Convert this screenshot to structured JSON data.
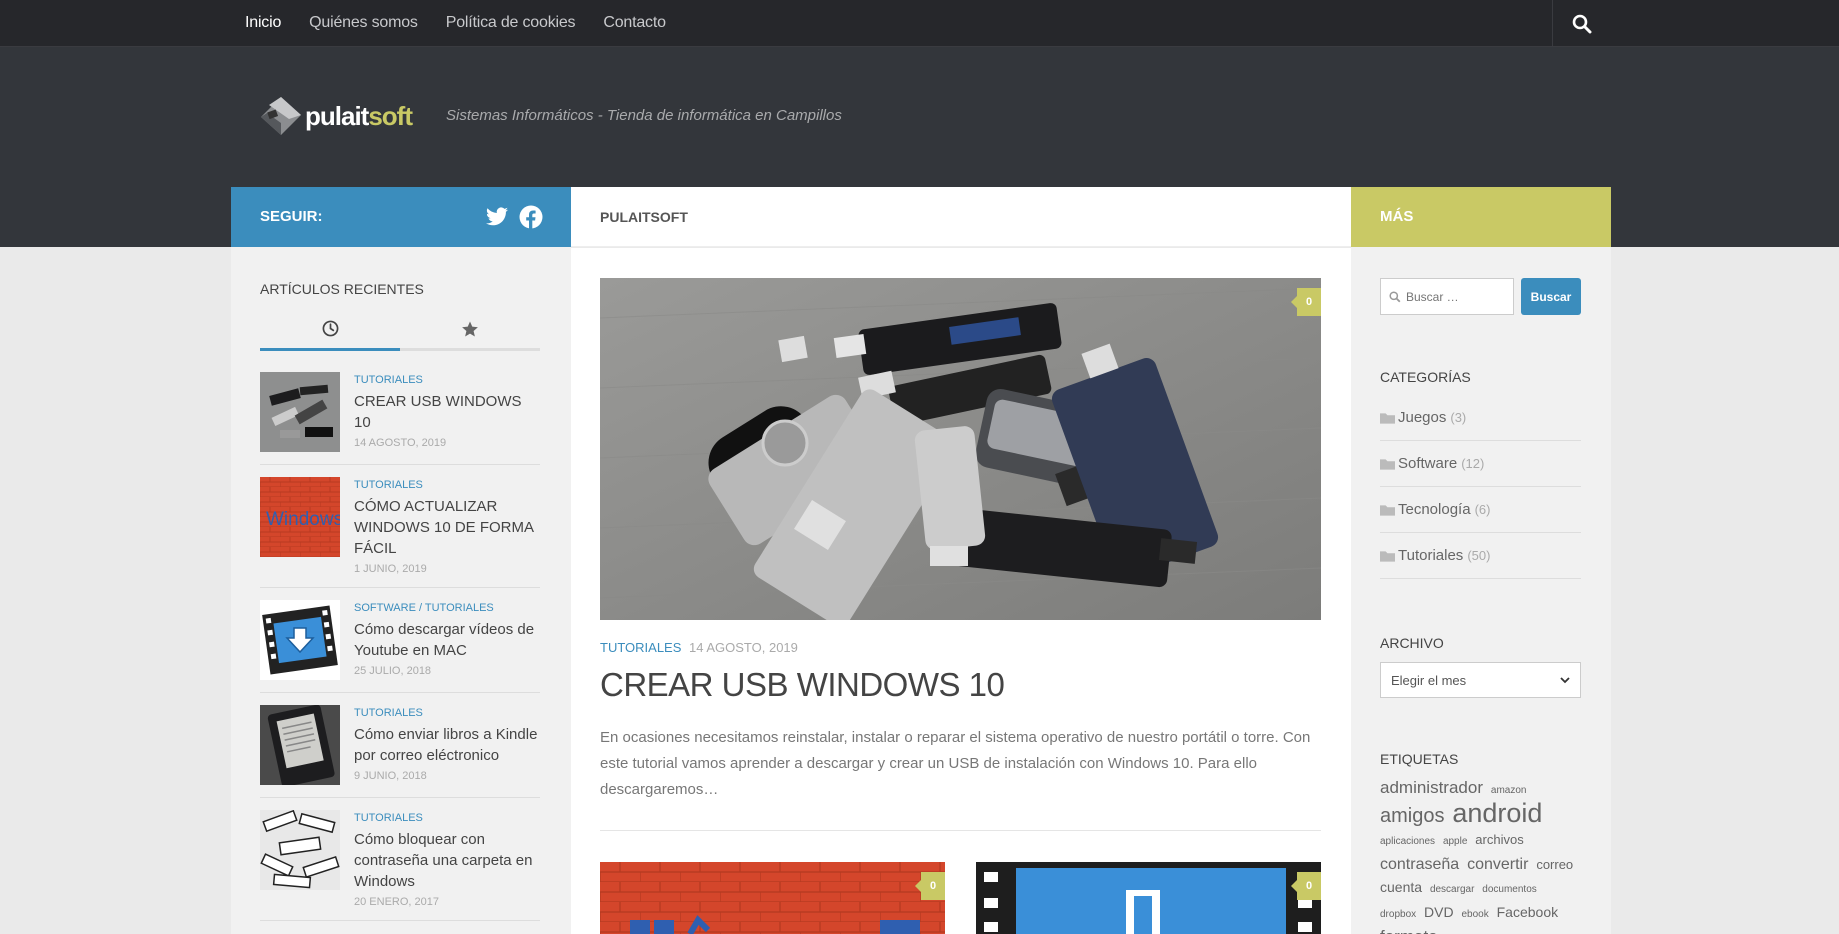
{
  "topnav": {
    "items": [
      "Inicio",
      "Quiénes somos",
      "Política de cookies",
      "Contacto"
    ],
    "active": "Inicio",
    "search_icon": "search-icon"
  },
  "header": {
    "logo_part1": "pulait",
    "logo_part2": "soft",
    "tagline": "Sistemas Informáticos - Tienda de informática en Campillos"
  },
  "bars": {
    "follow_label": "SEGUIR:",
    "follow_icons": [
      "twitter-icon",
      "facebook-icon"
    ],
    "main_title": "PULAITSOFT",
    "more_label": "MÁS"
  },
  "recent": {
    "title": "ARTÍCULOS RECIENTES",
    "tabs": [
      "clock-icon",
      "star-icon"
    ],
    "posts": [
      {
        "category": "TUTORIALES",
        "title": "CREAR USB WINDOWS 10",
        "date": "14 AGOSTO, 2019"
      },
      {
        "category": "TUTORIALES",
        "title": "CÓMO ACTUALIZAR WINDOWS 10 DE FORMA FÁCIL",
        "date": "1 JUNIO, 2019"
      },
      {
        "category": "SOFTWARE / TUTORIALES",
        "title": "Cómo descargar vídeos de Youtube en MAC",
        "date": "25 JULIO, 2018"
      },
      {
        "category": "TUTORIALES",
        "title": "Cómo enviar libros a Kindle por correo eléctronico",
        "date": "9 JUNIO, 2018"
      },
      {
        "category": "TUTORIALES",
        "title": "Cómo bloquear con contraseña una carpeta en Windows",
        "date": "20 ENERO, 2017"
      }
    ],
    "thumb_text_windows": "Windows"
  },
  "main": {
    "comment_count": "0",
    "category": "TUTORIALES",
    "date": "14 AGOSTO, 2019",
    "title": "CREAR USB WINDOWS 10",
    "excerpt": "En ocasiones necesitamos reinstalar, instalar o reparar el sistema operativo de nuestro portátil o torre.  Con este tutorial vamos aprender a descargar y crear un USB de instalación con Windows 10. Para ello descargaremos…",
    "grid_comment_counts": [
      "0",
      "0"
    ]
  },
  "sidebar_right": {
    "search_placeholder": "Buscar …",
    "search_button": "Buscar",
    "categories_title": "CATEGORÍAS",
    "categories": [
      {
        "name": "Juegos",
        "count": "(3)"
      },
      {
        "name": "Software",
        "count": "(12)"
      },
      {
        "name": "Tecnología",
        "count": "(6)"
      },
      {
        "name": "Tutoriales",
        "count": "(50)"
      }
    ],
    "archive_title": "ARCHIVO",
    "archive_select": "Elegir el mes",
    "tags_title": "ETIQUETAS",
    "tags": [
      {
        "t": "administrador",
        "s": 17
      },
      {
        "t": "amazon",
        "s": 10
      },
      {
        "t": "amigos",
        "s": 20
      },
      {
        "t": "android",
        "s": 27
      },
      {
        "t": "aplicaciones",
        "s": 10
      },
      {
        "t": "apple",
        "s": 10
      },
      {
        "t": "archivos",
        "s": 13
      },
      {
        "t": "contraseña",
        "s": 16
      },
      {
        "t": "convertir",
        "s": 16
      },
      {
        "t": "correo",
        "s": 13
      },
      {
        "t": "cuenta",
        "s": 14
      },
      {
        "t": "descargar",
        "s": 10
      },
      {
        "t": "documentos",
        "s": 10
      },
      {
        "t": "dropbox",
        "s": 10
      },
      {
        "t": "DVD",
        "s": 14
      },
      {
        "t": "ebook",
        "s": 10
      },
      {
        "t": "Facebook",
        "s": 14
      },
      {
        "t": "formato",
        "s": 17
      }
    ]
  },
  "colors": {
    "blue": "#3b8dbd",
    "olive": "#c9c965",
    "dark": "#26272b",
    "header": "#33363b"
  }
}
